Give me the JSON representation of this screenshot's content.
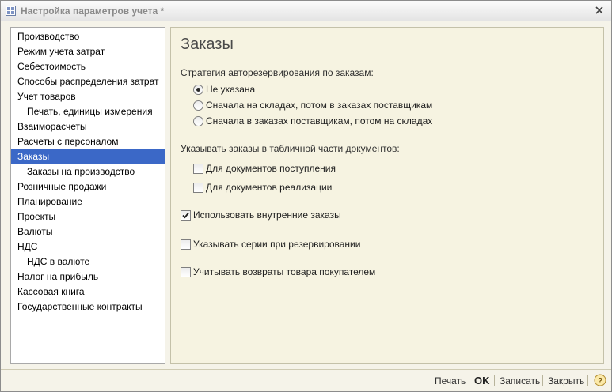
{
  "window": {
    "title": "Настройка параметров учета *"
  },
  "nav": {
    "items": [
      {
        "label": "Производство"
      },
      {
        "label": "Режим учета затрат"
      },
      {
        "label": "Себестоимость"
      },
      {
        "label": "Способы распределения затрат"
      },
      {
        "label": "Учет товаров"
      },
      {
        "label": "Печать, единицы измерения"
      },
      {
        "label": "Взаиморасчеты"
      },
      {
        "label": "Расчеты с персоналом"
      },
      {
        "label": "Заказы",
        "selected": true
      },
      {
        "label": "Заказы на производство"
      },
      {
        "label": "Розничные продажи"
      },
      {
        "label": "Планирование"
      },
      {
        "label": "Проекты"
      },
      {
        "label": "Валюты"
      },
      {
        "label": "НДС"
      },
      {
        "label": "НДС в валюте"
      },
      {
        "label": "Налог на прибыль"
      },
      {
        "label": "Кассовая книга"
      },
      {
        "label": "Государственные контракты"
      }
    ]
  },
  "page": {
    "title": "Заказы",
    "strategy": {
      "label": "Стратегия авторезервирования по заказам:",
      "options": [
        {
          "label": "Не указана",
          "selected": true
        },
        {
          "label": "Сначала на складах, потом в заказах поставщикам",
          "selected": false
        },
        {
          "label": "Сначала в заказах поставщикам, потом на складах",
          "selected": false
        }
      ]
    },
    "table_orders": {
      "label": "Указывать заказы в табличной части документов:",
      "receipt_docs": {
        "label": "Для документов поступления",
        "checked": false
      },
      "sales_docs": {
        "label": "Для документов реализации",
        "checked": false
      }
    },
    "internal_orders": {
      "label": "Использовать внутренние заказы",
      "checked": true
    },
    "series_reservation": {
      "label": "Указывать серии при резервировании",
      "checked": false
    },
    "customer_returns": {
      "label": "Учитывать возвраты товара покупателем",
      "checked": false
    }
  },
  "buttons": {
    "print": "Печать",
    "ok": "OK",
    "save": "Записать",
    "close": "Закрыть"
  },
  "colors": {
    "selection": "#3b68c7",
    "content_bg": "#f6f3e1"
  }
}
